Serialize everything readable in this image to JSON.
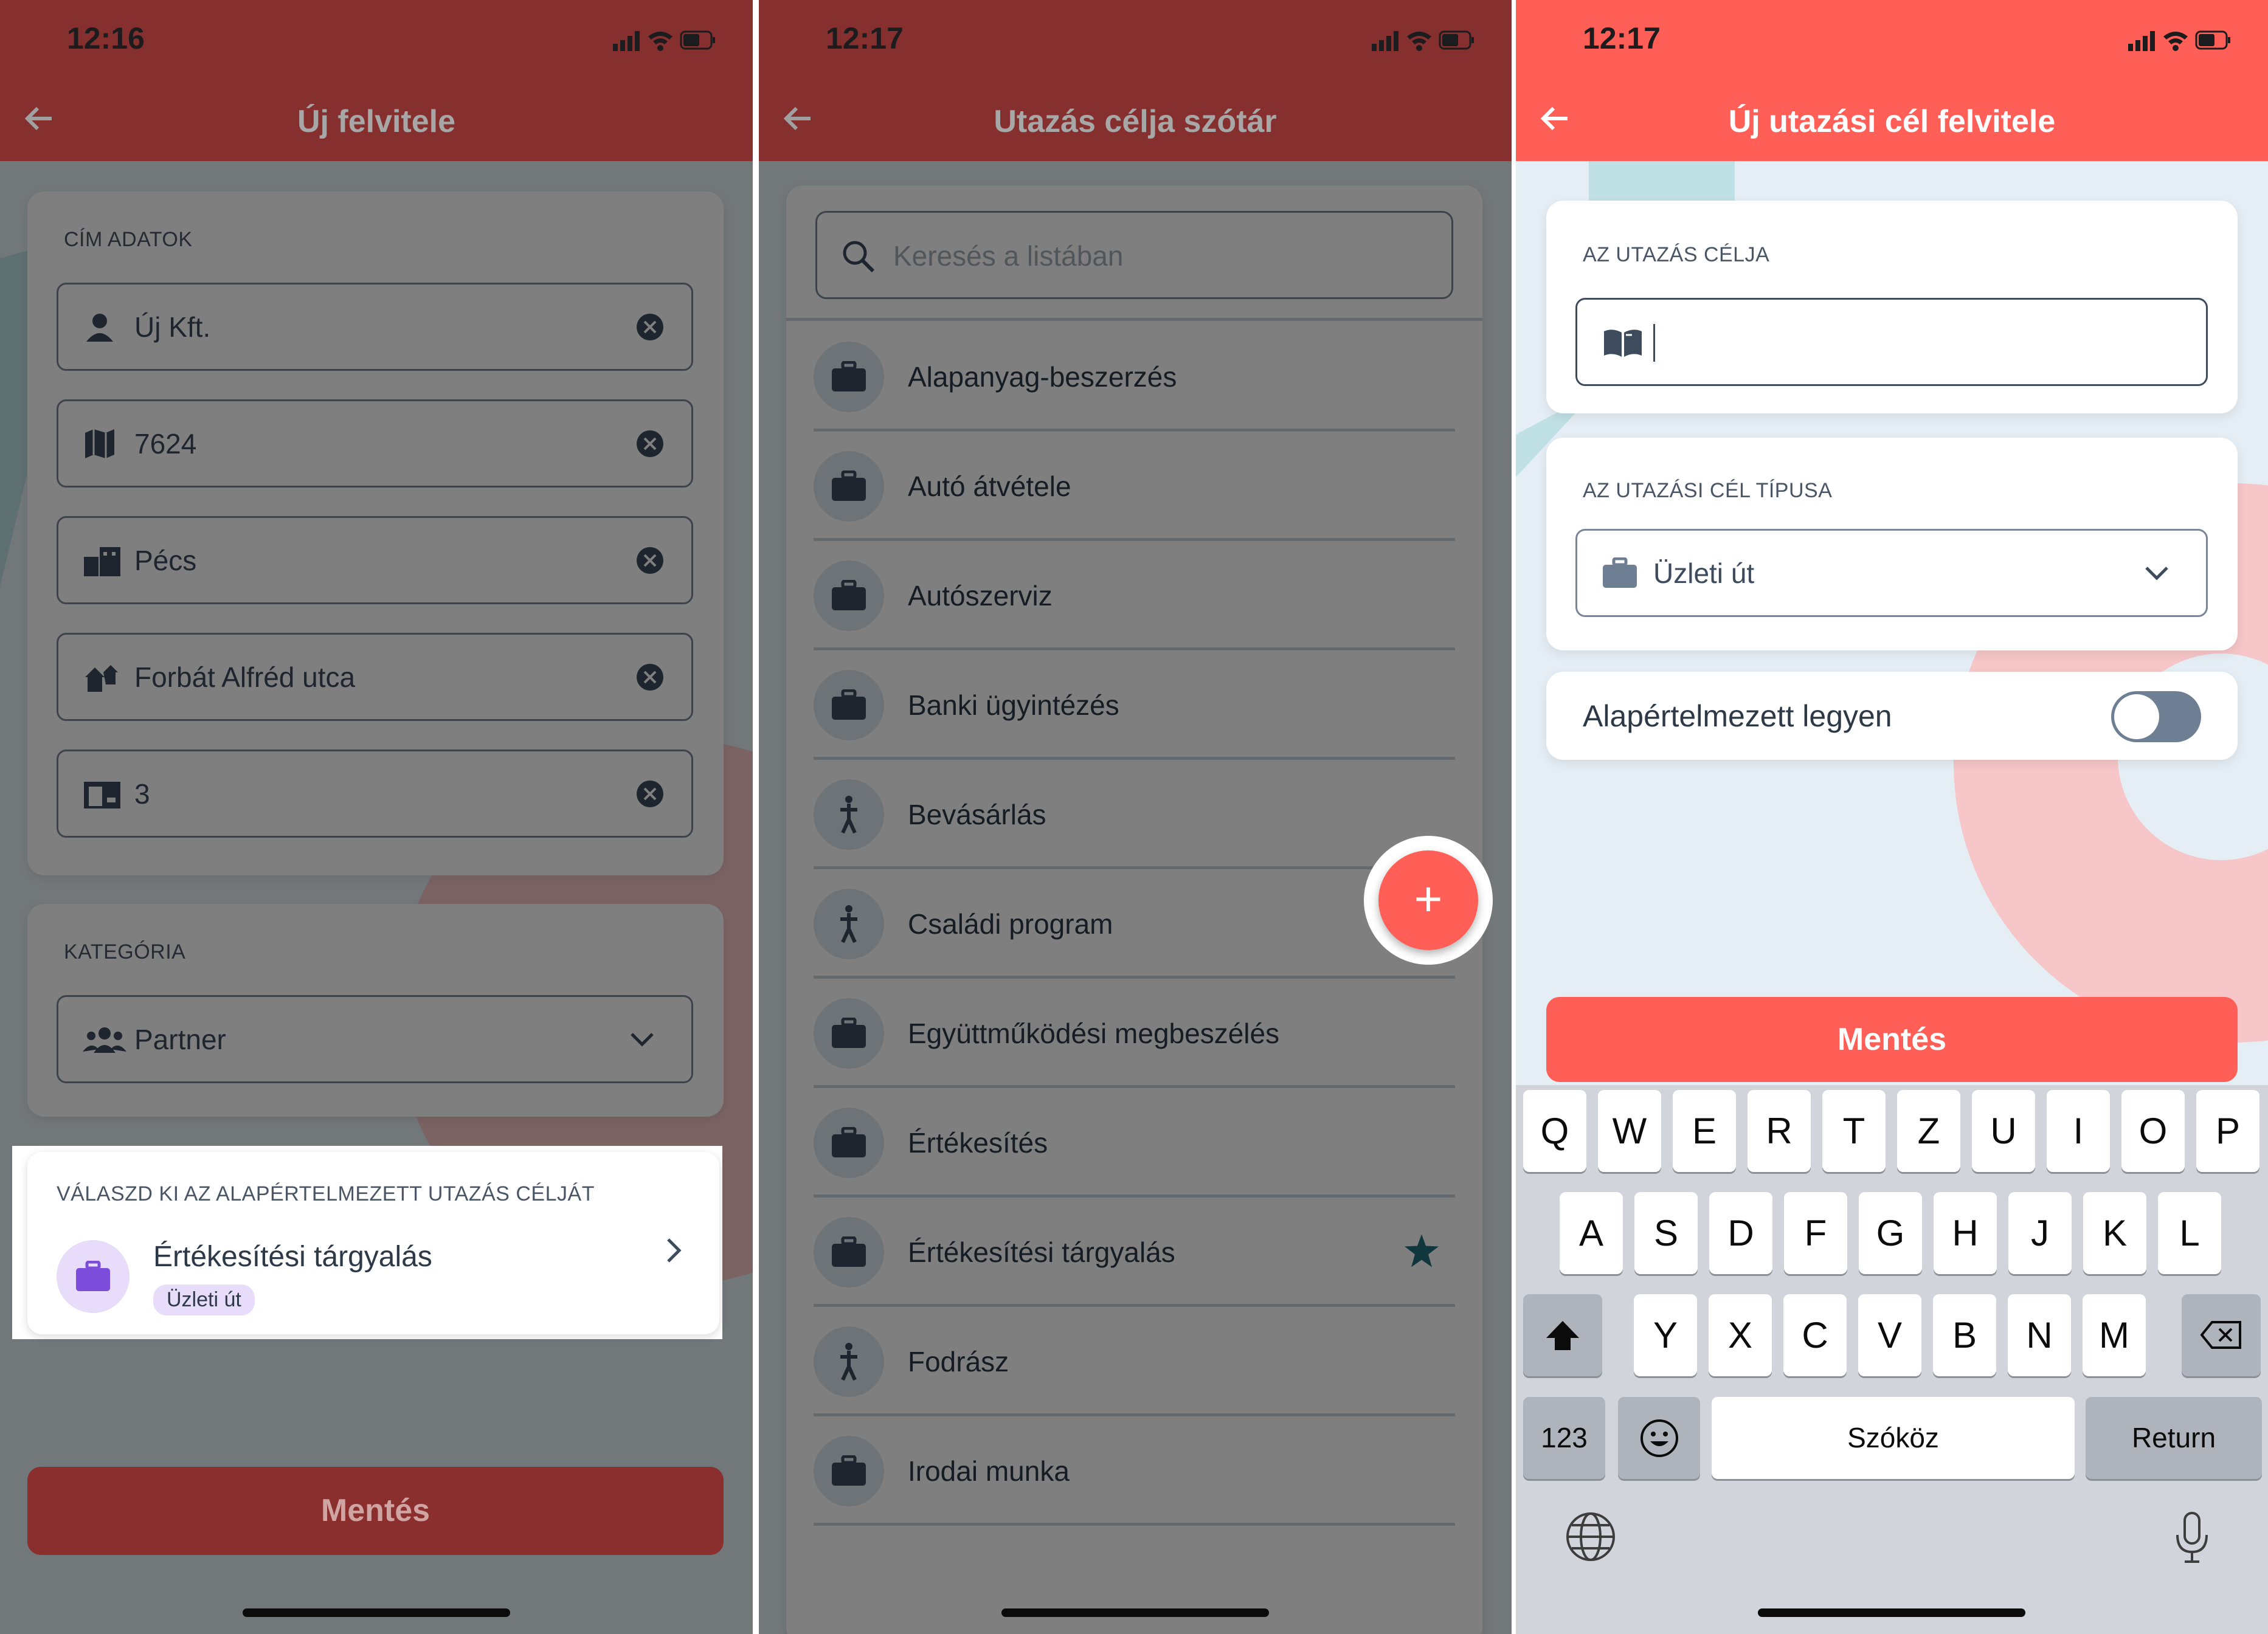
{
  "colors": {
    "brand": "#ff5f56",
    "brand_dimmed": "#85302e",
    "save_dimmed": "#8a2f2d",
    "accent_star": "#1e6f7a",
    "badge_bg": "#e8dcfb",
    "badge_icon": "#7c4ddb"
  },
  "screen1": {
    "time": "12:16",
    "title": "Új felvitele",
    "address_section": "CÍM ADATOK",
    "fields": [
      {
        "value": "Új Kft.",
        "icon": "person-icon"
      },
      {
        "value": "7624",
        "icon": "map-icon"
      },
      {
        "value": "Pécs",
        "icon": "city-icon"
      },
      {
        "value": "Forbát Alfréd utca",
        "icon": "street-icon"
      },
      {
        "value": "3",
        "icon": "door-icon"
      }
    ],
    "category_section": "KATEGÓRIA",
    "category_value": "Partner",
    "default_purpose_label": "VÁLASZD KI AZ ALAPÉRTELMEZETT UTAZÁS CÉLJÁT",
    "default_purpose_value": "Értékesítési tárgyalás",
    "default_purpose_badge": "Üzleti út",
    "save": "Mentés"
  },
  "screen2": {
    "time": "12:17",
    "title": "Utazás célja szótár",
    "search_placeholder": "Keresés a listában",
    "items": [
      {
        "label": "Alapanyag-beszerzés",
        "icon": "briefcase-icon"
      },
      {
        "label": "Autó átvétele",
        "icon": "briefcase-icon"
      },
      {
        "label": "Autószerviz",
        "icon": "briefcase-icon"
      },
      {
        "label": "Banki ügyintézés",
        "icon": "briefcase-icon"
      },
      {
        "label": "Bevásárlás",
        "icon": "person-walking-icon"
      },
      {
        "label": "Családi program",
        "icon": "person-walking-icon"
      },
      {
        "label": "Együttműködési megbeszélés",
        "icon": "briefcase-icon"
      },
      {
        "label": "Értékesítés",
        "icon": "briefcase-icon"
      },
      {
        "label": "Értékesítési tárgyalás",
        "icon": "briefcase-icon",
        "starred": true
      },
      {
        "label": "Fodrász",
        "icon": "person-walking-icon"
      },
      {
        "label": "Irodai munka",
        "icon": "briefcase-icon"
      }
    ],
    "fab": "+"
  },
  "screen3": {
    "time": "12:17",
    "title": "Új utazási cél felvitele",
    "purpose_section": "AZ UTAZÁS CÉLJA",
    "purpose_value": "",
    "type_section": "AZ UTAZÁSI CÉL TÍPUSA",
    "type_value": "Üzleti út",
    "default_toggle_label": "Alapértelmezett legyen",
    "default_toggle_on": false,
    "save": "Mentés",
    "keyboard": {
      "row1": [
        "Q",
        "W",
        "E",
        "R",
        "T",
        "Z",
        "U",
        "I",
        "O",
        "P"
      ],
      "row2": [
        "A",
        "S",
        "D",
        "F",
        "G",
        "H",
        "J",
        "K",
        "L"
      ],
      "row3": [
        "Y",
        "X",
        "C",
        "V",
        "B",
        "N",
        "M"
      ],
      "numbers": "123",
      "space": "Szóköz",
      "return": "Return"
    }
  }
}
